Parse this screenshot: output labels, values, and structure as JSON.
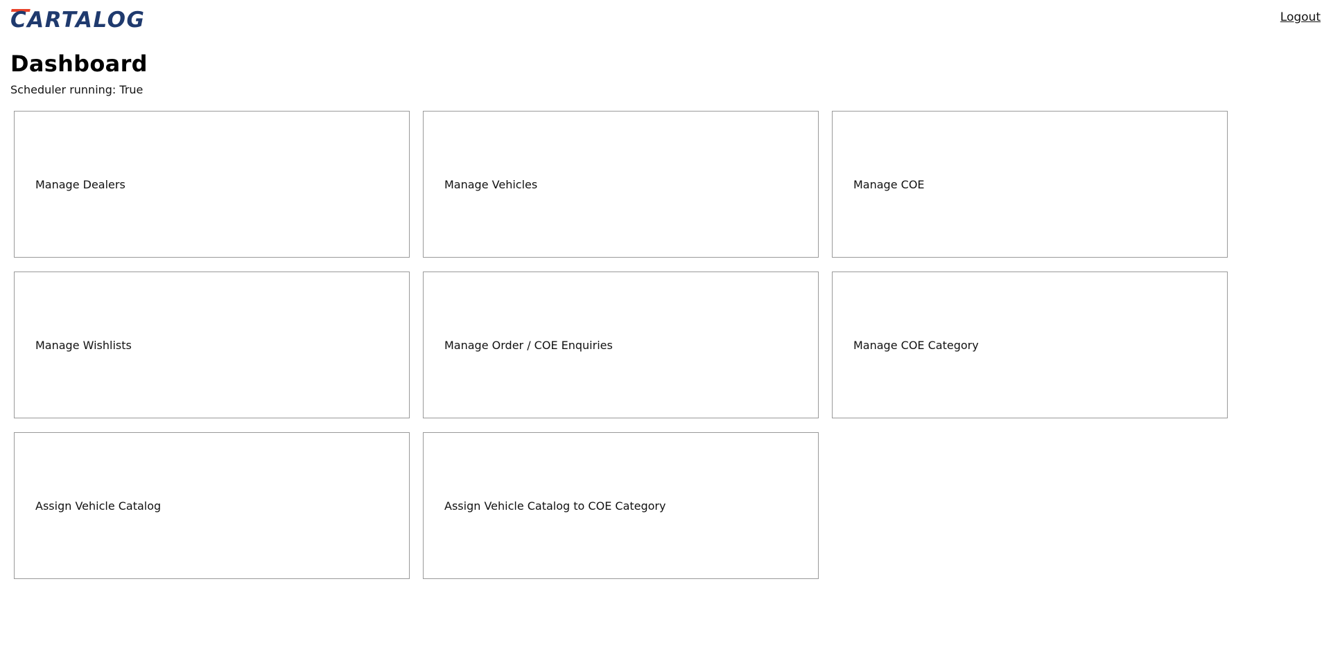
{
  "header": {
    "logo_text": "CARTALOG",
    "logout_label": "Logout",
    "brand_colors": {
      "primary": "#1f3a6e",
      "accent": "#e8432a"
    }
  },
  "page": {
    "title": "Dashboard",
    "status_text": "Scheduler running: True"
  },
  "cards": [
    {
      "label": "Manage Dealers"
    },
    {
      "label": "Manage Vehicles"
    },
    {
      "label": "Manage COE"
    },
    {
      "label": "Manage Wishlists"
    },
    {
      "label": "Manage Order / COE Enquiries"
    },
    {
      "label": "Manage COE Category"
    },
    {
      "label": "Assign Vehicle Catalog"
    },
    {
      "label": "Assign Vehicle Catalog to COE Category"
    }
  ]
}
